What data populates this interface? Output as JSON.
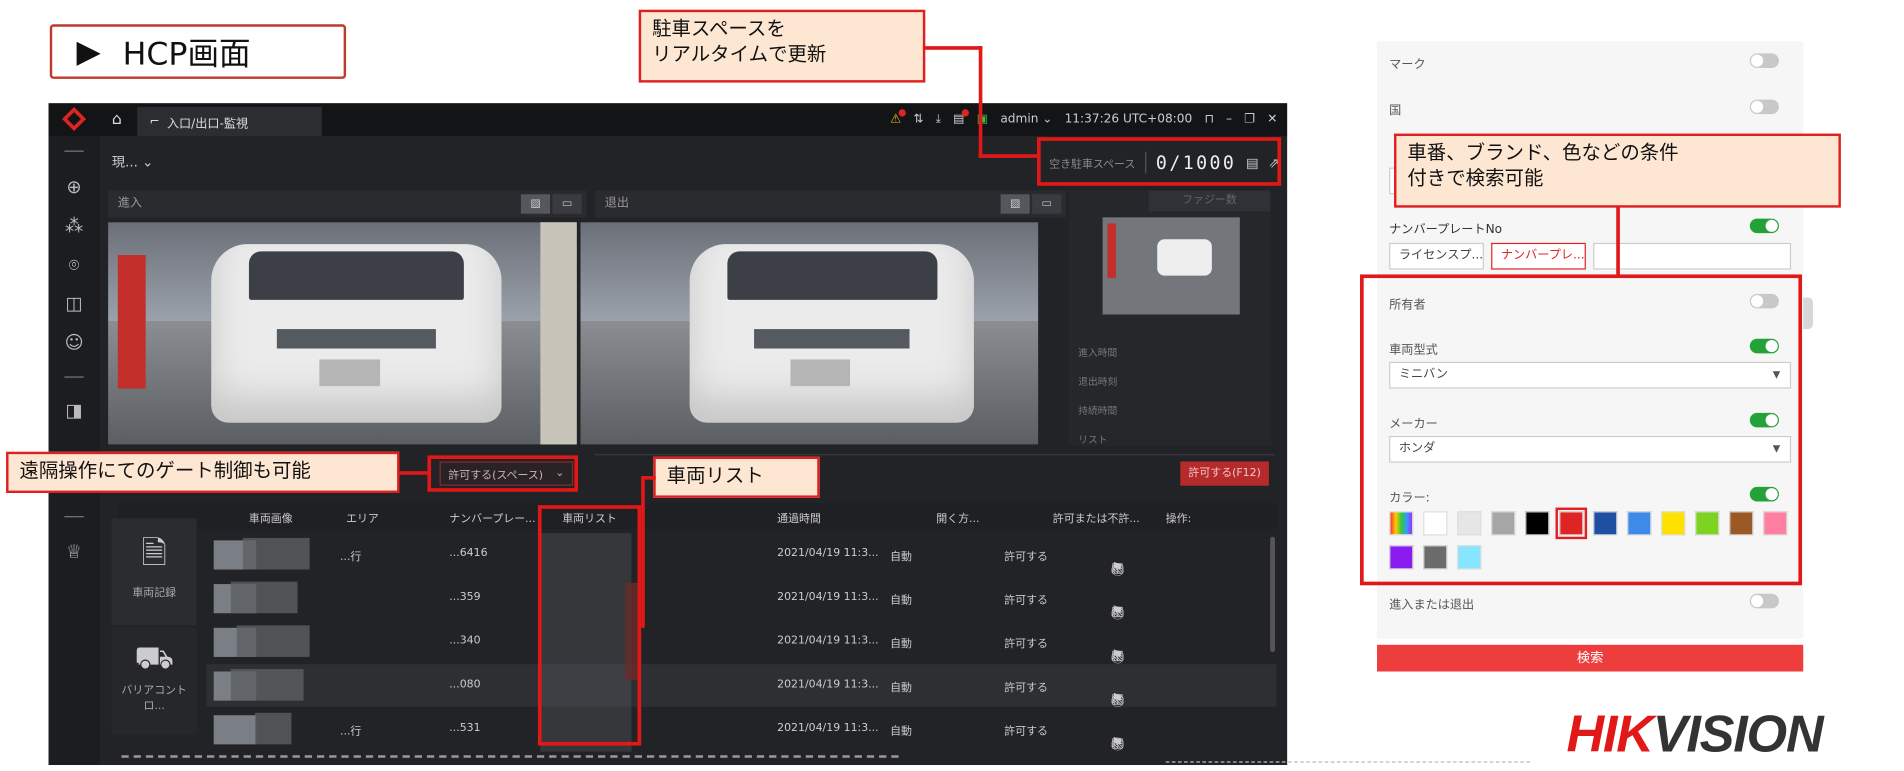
{
  "slide": {
    "title": "HCP画面",
    "title_marker": "▶"
  },
  "app": {
    "tab_label": "入口/出口-監視",
    "user": "admin",
    "clock": "11:37:26 UTC+08:00",
    "view_label": "現...",
    "parking": {
      "label": "空き駐車スペース",
      "value": "0/1000"
    },
    "entrance_label": "進入",
    "exit_label": "退出",
    "fuzzy_button": "ファジー数",
    "info_rows": [
      "進入時間",
      "退出時刻",
      "持続時間",
      "リスト"
    ],
    "allow_space_button": "許可する(スペース)",
    "allow_f12_button": "許可する(F12)",
    "table": {
      "headers": [
        "車両画像",
        "エリア",
        "ナンバープレー...",
        "車両リスト",
        "通過時間",
        "開く方...",
        "許可または不許...",
        "操作:"
      ],
      "rows": [
        {
          "area": "...行",
          "plate": "...6416",
          "time": "2021/04/19 11:3...",
          "open_mode": "自動",
          "permit": "許可する"
        },
        {
          "area": "",
          "plate": "...359",
          "time": "2021/04/19 11:3...",
          "open_mode": "自動",
          "permit": "許可する"
        },
        {
          "area": "",
          "plate": "...340",
          "time": "2021/04/19 11:3...",
          "open_mode": "自動",
          "permit": "許可する"
        },
        {
          "area": "",
          "plate": "...080",
          "time": "2021/04/19 11:3...",
          "open_mode": "自動",
          "permit": "許可する"
        },
        {
          "area": "...行",
          "plate": "...531",
          "time": "2021/04/19 11:3...",
          "open_mode": "自動",
          "permit": "許可する"
        }
      ]
    },
    "vehicle_record_label": "車両記録",
    "barrier_control_label": "バリアコントロ..."
  },
  "annotations": {
    "parking_realtime": [
      "駐車スペースを",
      "リアルタイムで更新"
    ],
    "search_conditions": [
      "車番、ブランド、色などの条件",
      "付きで検索可能"
    ],
    "remote_gate": "遠隔操作にてのゲート制御も可能",
    "vehicle_list": "車両リスト"
  },
  "search_panel": {
    "mark": "マーク",
    "country": "国",
    "plate_no": "ナンバープレートNo",
    "plate_opt1": "ライセンスプ...",
    "plate_opt2": "ナンバープレ...",
    "owner": "所有者",
    "vehicle_type": "車両型式",
    "vehicle_type_value": "ミニバン",
    "maker": "メーカー",
    "maker_value": "ホンダ",
    "color": "カラー:",
    "in_out": "進入または退出",
    "search_button": "検索",
    "swatch_colors": [
      "#multicolor",
      "#ffffff",
      "#e6e6e6",
      "#a6a6a6",
      "#000000",
      "#e02424",
      "#1f4fa3",
      "#3d8be8",
      "#ffe100",
      "#7ed321",
      "#9b5a25",
      "#ff7fa0",
      "#8b1cf0",
      "#6b6b6b",
      "#86e6ff"
    ]
  },
  "brand": {
    "part1": "HIK",
    "part2": "VISION"
  }
}
